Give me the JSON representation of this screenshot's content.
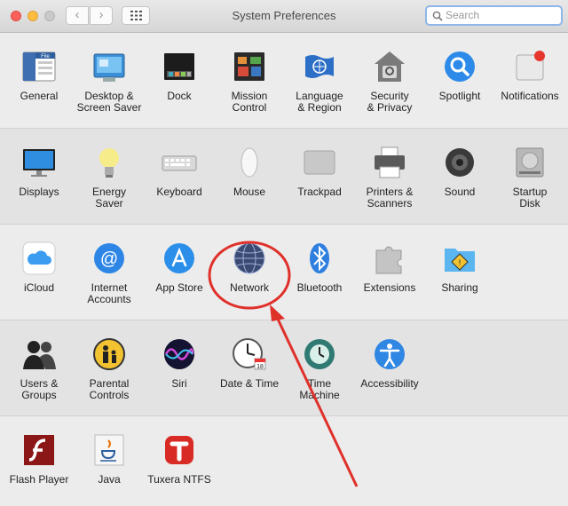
{
  "window": {
    "title": "System Preferences"
  },
  "toolbar": {
    "back_glyph": "‹",
    "forward_glyph": "›",
    "search_placeholder": "Search"
  },
  "rows": [
    [
      {
        "name": "general",
        "label": "General",
        "icon": "general-icon"
      },
      {
        "name": "desktop-screen-saver",
        "label": "Desktop &\nScreen Saver",
        "icon": "desktop-icon"
      },
      {
        "name": "dock",
        "label": "Dock",
        "icon": "dock-icon"
      },
      {
        "name": "mission-control",
        "label": "Mission\nControl",
        "icon": "mission-control-icon"
      },
      {
        "name": "language-region",
        "label": "Language\n& Region",
        "icon": "flag-icon"
      },
      {
        "name": "security-privacy",
        "label": "Security\n& Privacy",
        "icon": "house-lock-icon"
      },
      {
        "name": "spotlight",
        "label": "Spotlight",
        "icon": "magnifier-icon"
      },
      {
        "name": "notifications",
        "label": "Notifications",
        "icon": "notifications-icon"
      }
    ],
    [
      {
        "name": "displays",
        "label": "Displays",
        "icon": "monitor-icon"
      },
      {
        "name": "energy-saver",
        "label": "Energy\nSaver",
        "icon": "lightbulb-icon"
      },
      {
        "name": "keyboard",
        "label": "Keyboard",
        "icon": "keyboard-icon"
      },
      {
        "name": "mouse",
        "label": "Mouse",
        "icon": "mouse-icon"
      },
      {
        "name": "trackpad",
        "label": "Trackpad",
        "icon": "trackpad-icon"
      },
      {
        "name": "printers-scanners",
        "label": "Printers &\nScanners",
        "icon": "printer-icon"
      },
      {
        "name": "sound",
        "label": "Sound",
        "icon": "speaker-icon"
      },
      {
        "name": "startup-disk",
        "label": "Startup\nDisk",
        "icon": "hard-disk-icon"
      }
    ],
    [
      {
        "name": "icloud",
        "label": "iCloud",
        "icon": "cloud-icon"
      },
      {
        "name": "internet-accounts",
        "label": "Internet\nAccounts",
        "icon": "at-sign-icon"
      },
      {
        "name": "app-store",
        "label": "App Store",
        "icon": "app-store-icon"
      },
      {
        "name": "network",
        "label": "Network",
        "icon": "globe-icon"
      },
      {
        "name": "bluetooth",
        "label": "Bluetooth",
        "icon": "bluetooth-icon"
      },
      {
        "name": "extensions",
        "label": "Extensions",
        "icon": "puzzle-icon"
      },
      {
        "name": "sharing",
        "label": "Sharing",
        "icon": "sharing-folder-icon"
      }
    ],
    [
      {
        "name": "users-groups",
        "label": "Users &\nGroups",
        "icon": "users-icon"
      },
      {
        "name": "parental-controls",
        "label": "Parental\nControls",
        "icon": "parental-icon"
      },
      {
        "name": "siri",
        "label": "Siri",
        "icon": "siri-icon"
      },
      {
        "name": "date-time",
        "label": "Date & Time",
        "icon": "clock-calendar-icon"
      },
      {
        "name": "time-machine",
        "label": "Time\nMachine",
        "icon": "time-machine-icon"
      },
      {
        "name": "accessibility",
        "label": "Accessibility",
        "icon": "accessibility-icon"
      }
    ],
    [
      {
        "name": "flash-player",
        "label": "Flash Player",
        "icon": "flash-icon"
      },
      {
        "name": "java",
        "label": "Java",
        "icon": "java-icon"
      },
      {
        "name": "tuxera-ntfs",
        "label": "Tuxera NTFS",
        "icon": "tuxera-icon"
      }
    ]
  ],
  "colors": {
    "annotation": "#e0302a",
    "search_focus": "#8fb6e9"
  }
}
